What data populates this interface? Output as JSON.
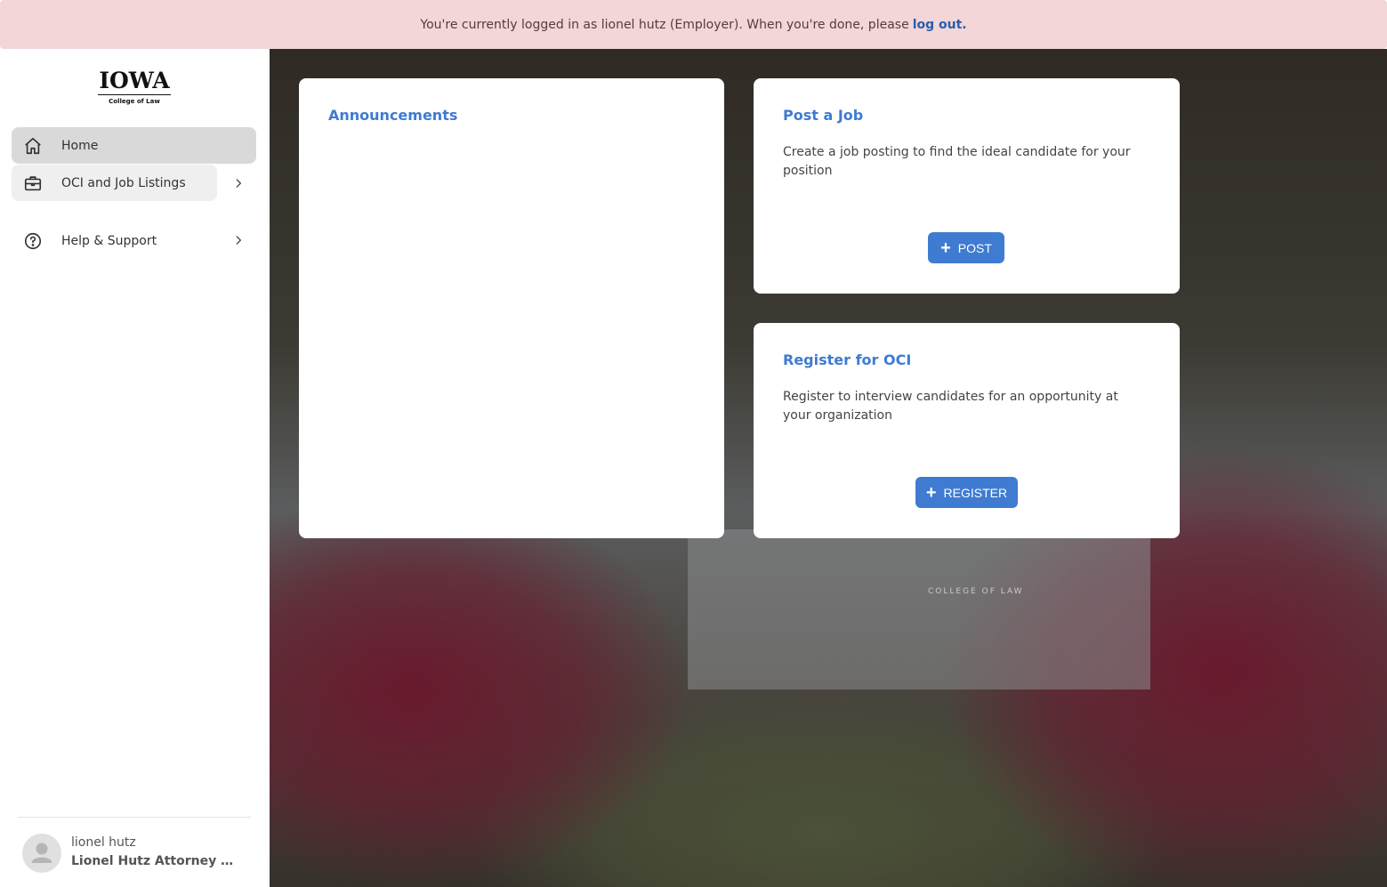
{
  "banner": {
    "message": "You're currently logged in as lionel hutz (Employer). When you're done, please",
    "logout_link": "log out."
  },
  "logo": {
    "wordmark": "IOWA",
    "subtitle": "College of Law"
  },
  "sidebar": {
    "items": [
      {
        "label": "Home",
        "icon": "home-icon"
      },
      {
        "label": "OCI and Job Listings",
        "icon": "briefcase-icon"
      },
      {
        "label": "Help & Support",
        "icon": "help-circle-icon"
      }
    ]
  },
  "user": {
    "name": "lionel hutz",
    "organization": "Lionel Hutz Attorney at Law"
  },
  "cards": {
    "announcements": {
      "title": "Announcements"
    },
    "post_job": {
      "title": "Post a Job",
      "description": "Create a job posting to find the ideal candidate for your position",
      "button_label": "POST"
    },
    "register_oci": {
      "title": "Register for OCI",
      "description": "Register to interview candidates for an opportunity at your organization",
      "button_label": "REGISTER"
    }
  },
  "background": {
    "sign_text": "COLLEGE OF LAW"
  },
  "colors": {
    "accent": "#3f7bd1",
    "banner": "#f2d6d8",
    "nav_active": "#d9d9d9"
  }
}
